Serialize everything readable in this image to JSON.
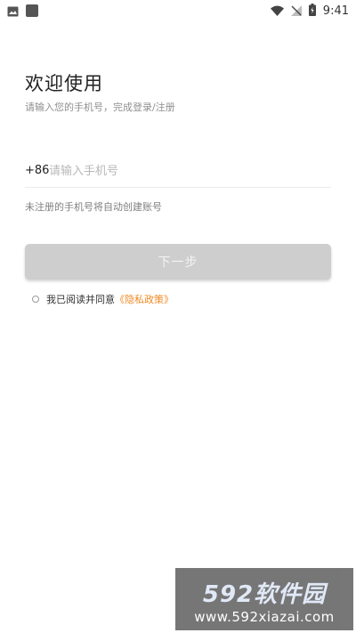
{
  "status_bar": {
    "time": "9:41",
    "icons": [
      "image-icon",
      "app-icon",
      "wifi-icon",
      "signal-icon",
      "battery-icon"
    ]
  },
  "header": {
    "title": "欢迎使用",
    "subtitle": "请输入您的手机号，完成登录/注册"
  },
  "phone": {
    "country_code": "+86",
    "placeholder": "请输入手机号",
    "value": "",
    "hint": "未注册的手机号将自动创建账号"
  },
  "next_button": {
    "label": "下一步"
  },
  "agreement": {
    "checked": false,
    "text": "我已阅读并同意",
    "link_text": "《隐私政策》"
  },
  "watermark": {
    "logo_text": "592软件园",
    "url": "www.592xiazai.com"
  },
  "colors": {
    "background": "#ffffff",
    "button_disabled": "#cecece",
    "link": "#f08a23",
    "text_primary": "#222222",
    "text_secondary": "#8f8f8f"
  }
}
